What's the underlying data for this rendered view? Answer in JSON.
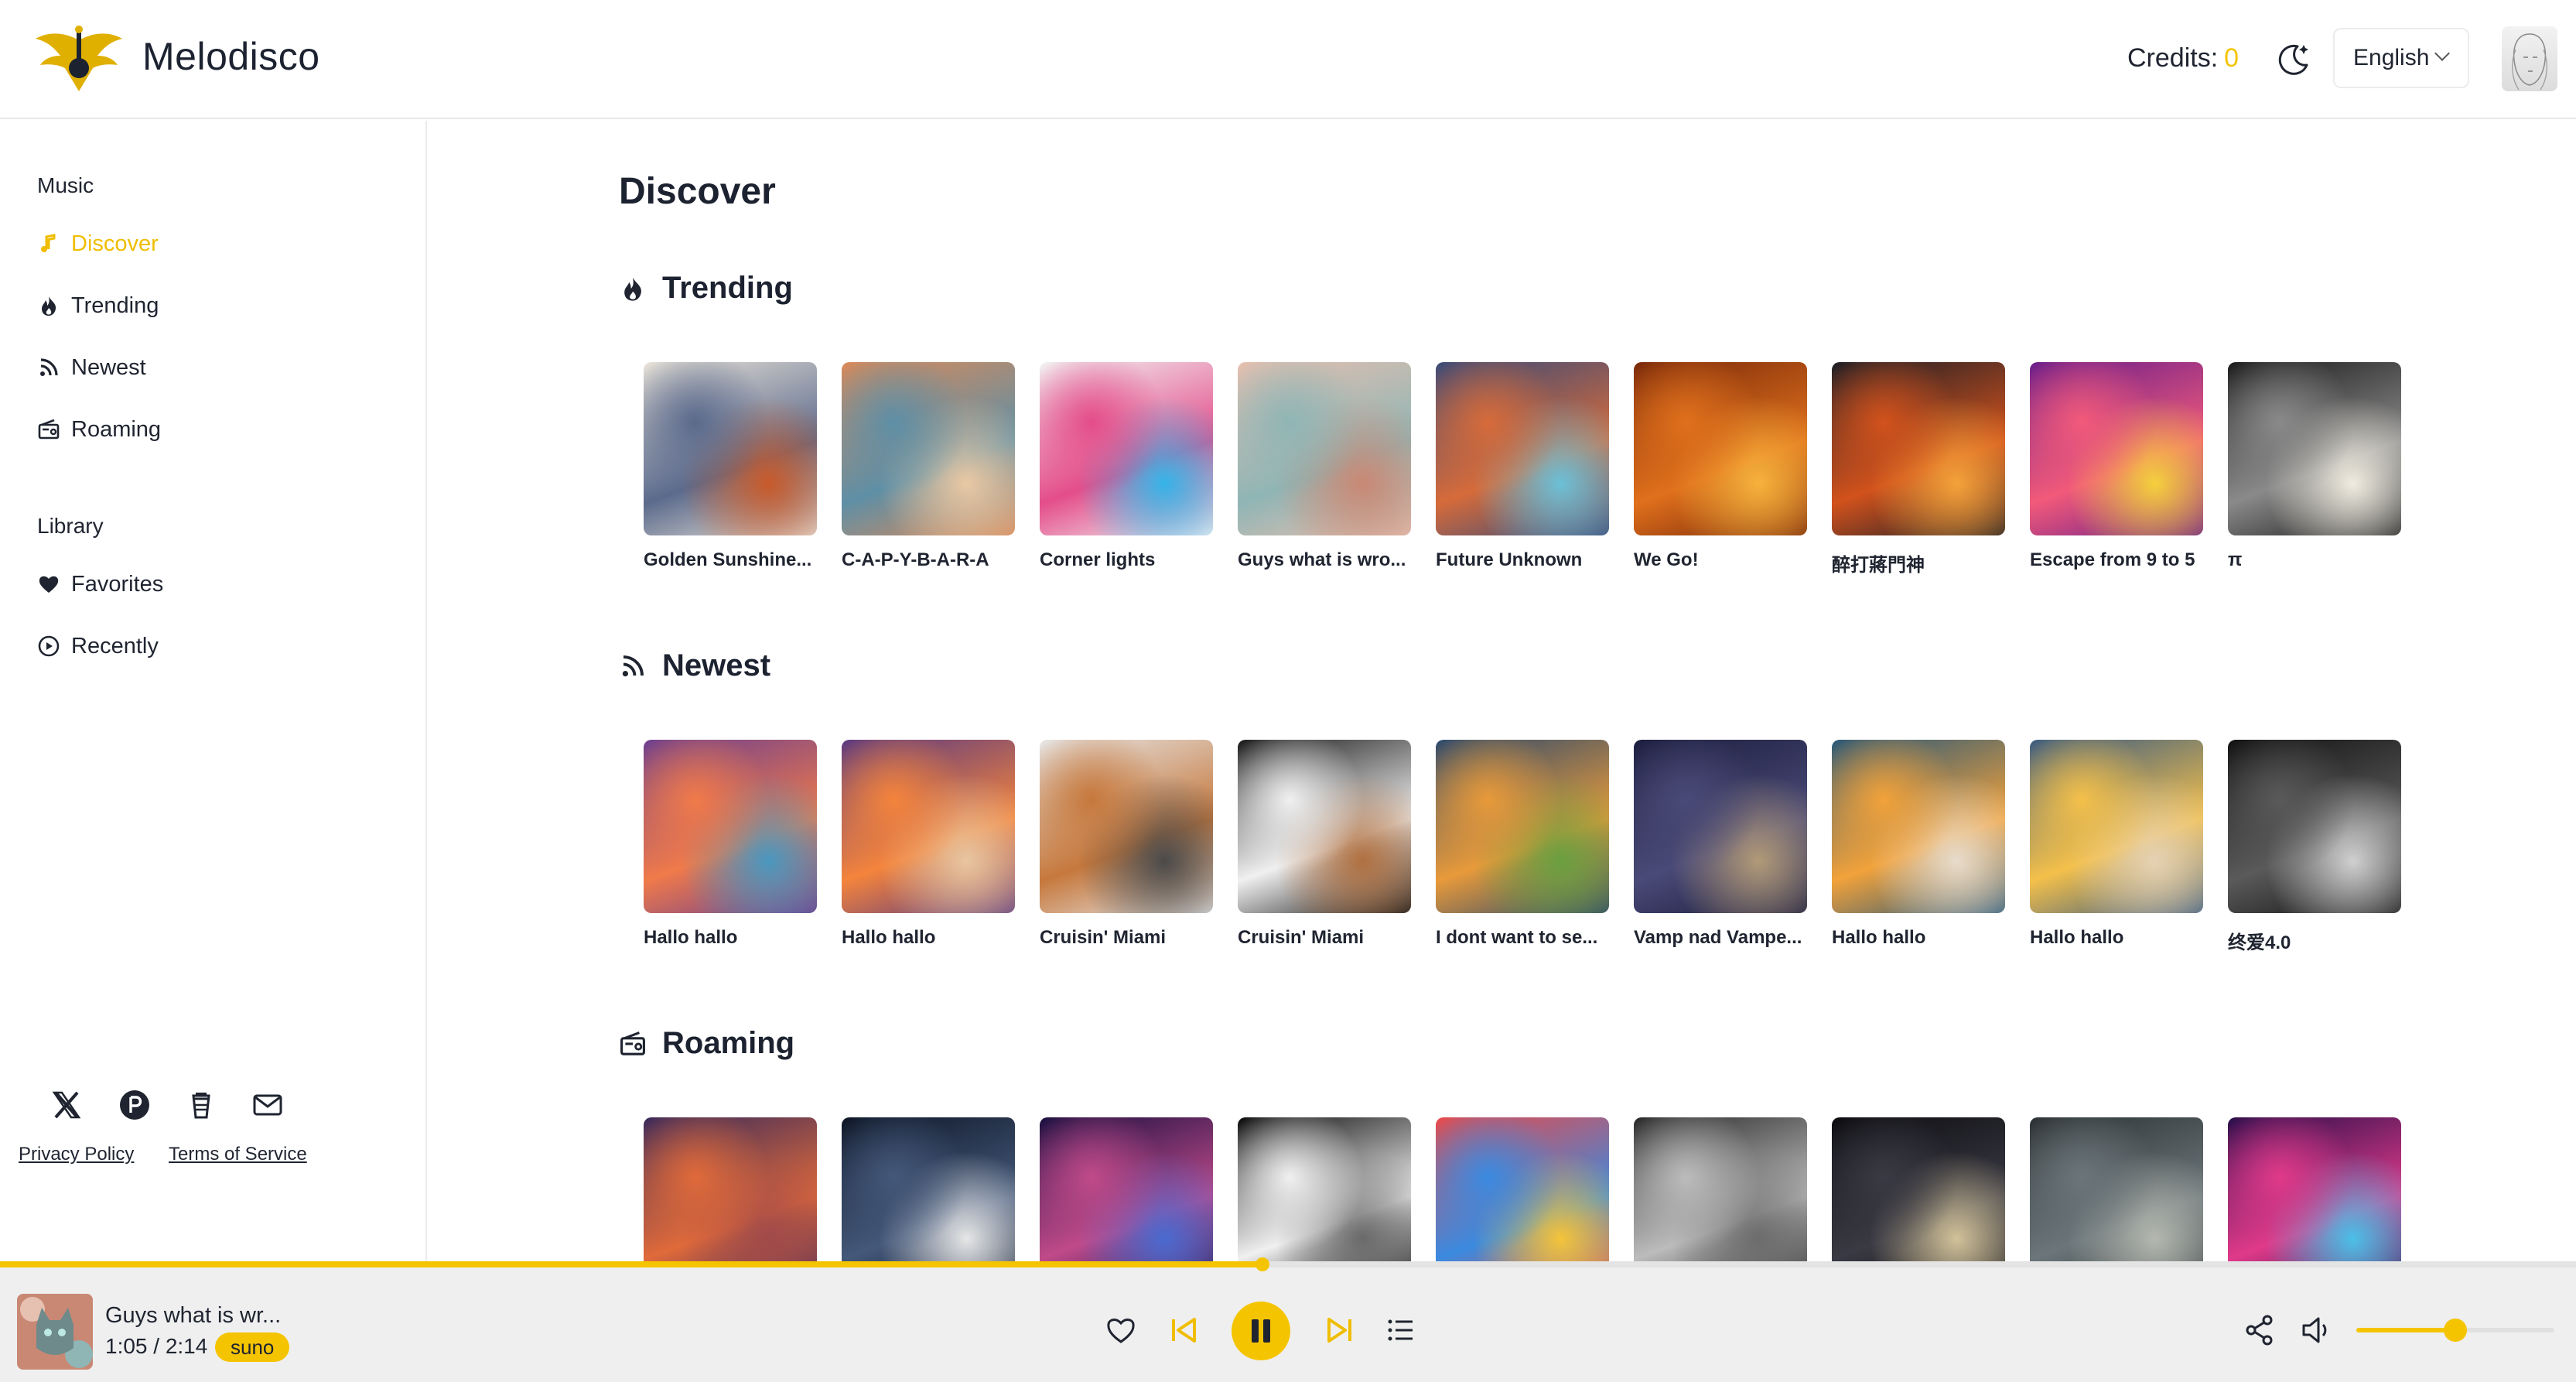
{
  "header": {
    "brand": "Melodisco",
    "credits_label": "Credits:",
    "credits_value": "0",
    "language": "English"
  },
  "sidebar": {
    "music_title": "Music",
    "music_items": [
      {
        "label": "Discover",
        "icon": "music-note-icon",
        "active": true
      },
      {
        "label": "Trending",
        "icon": "flame-icon",
        "active": false
      },
      {
        "label": "Newest",
        "icon": "rss-icon",
        "active": false
      },
      {
        "label": "Roaming",
        "icon": "radio-icon",
        "active": false
      }
    ],
    "library_title": "Library",
    "library_items": [
      {
        "label": "Favorites",
        "icon": "heart-icon"
      },
      {
        "label": "Recently",
        "icon": "play-circle-icon"
      }
    ],
    "social_icons": [
      "x-icon",
      "product-hunt-icon",
      "coffee-cup-icon",
      "mail-icon"
    ],
    "footer_links": [
      "Privacy Policy",
      "Terms of Service"
    ]
  },
  "main": {
    "title": "Discover",
    "sections": [
      {
        "title": "Trending",
        "icon": "flame-icon",
        "cards": [
          {
            "label": "Golden Sunshine...",
            "colors": [
              "#e8e2d8",
              "#5b6a8c",
              "#c85a2a"
            ]
          },
          {
            "label": "C-A-P-Y-B-A-R-A",
            "colors": [
              "#d98a5a",
              "#5e8fa6",
              "#e9c9a4"
            ]
          },
          {
            "label": "Corner lights",
            "colors": [
              "#f2f2f2",
              "#e44d8a",
              "#35b4e8"
            ]
          },
          {
            "label": "Guys what is wro...",
            "colors": [
              "#e6c0b0",
              "#8fb5b5",
              "#c98874"
            ]
          },
          {
            "label": "Future Unknown",
            "colors": [
              "#3b4a78",
              "#d66b3a",
              "#6cc0d8"
            ]
          },
          {
            "label": "We Go!",
            "colors": [
              "#7a2a0a",
              "#e0701c",
              "#f6b23c"
            ]
          },
          {
            "label": "醉打蔣門神",
            "colors": [
              "#1e1e26",
              "#d2521c",
              "#f4a23a"
            ]
          },
          {
            "label": "Escape from 9 to 5",
            "colors": [
              "#6b1e8a",
              "#f25a7a",
              "#f4d03c"
            ]
          },
          {
            "label": "π",
            "colors": [
              "#1c1c1c",
              "#8a8a8a",
              "#f0ece0"
            ]
          }
        ]
      },
      {
        "title": "Newest",
        "icon": "rss-icon",
        "cards": [
          {
            "label": "Hallo hallo",
            "colors": [
              "#6d3f8e",
              "#f07a4a",
              "#4a98c0"
            ]
          },
          {
            "label": "Hallo hallo",
            "colors": [
              "#5c3a80",
              "#f4843c",
              "#e8c6a0"
            ]
          },
          {
            "label": "Cruisin' Miami",
            "colors": [
              "#e6e6e6",
              "#c6783c",
              "#4a4a4a"
            ]
          },
          {
            "label": "Cruisin' Miami",
            "colors": [
              "#1a1a1a",
              "#f0f0f0",
              "#b07040"
            ]
          },
          {
            "label": "I dont want to se...",
            "colors": [
              "#2e4a6c",
              "#e89a3a",
              "#6aa040"
            ]
          },
          {
            "label": "Vamp nad Vampe...",
            "colors": [
              "#1c1e3e",
              "#4a4a78",
              "#b29a78"
            ]
          },
          {
            "label": "Hallo hallo",
            "colors": [
              "#2a5878",
              "#f2a23a",
              "#e8dccc"
            ]
          },
          {
            "label": "Hallo hallo",
            "colors": [
              "#3c5c80",
              "#f4c04a",
              "#e6d2b4"
            ]
          },
          {
            "label": "终爱4.0",
            "colors": [
              "#121212",
              "#5a5a5a",
              "#d0d0d0"
            ]
          }
        ]
      },
      {
        "title": "Roaming",
        "icon": "radio-icon",
        "cards": [
          {
            "label": "",
            "colors": [
              "#3a2a5a",
              "#e06a3a",
              "#a04a4a"
            ]
          },
          {
            "label": "",
            "colors": [
              "#0e1626",
              "#44587a",
              "#e6e6e6"
            ]
          },
          {
            "label": "",
            "colors": [
              "#1a1040",
              "#c04a8a",
              "#4a6ad0"
            ]
          },
          {
            "label": "",
            "colors": [
              "#0c0c0c",
              "#f0f0f0",
              "#6a6a6a"
            ]
          },
          {
            "label": "",
            "colors": [
              "#e84a4a",
              "#3a8ae0",
              "#f4c43a"
            ]
          },
          {
            "label": "",
            "colors": [
              "#2a2a2a",
              "#bcbcbc",
              "#6c6c6c"
            ]
          },
          {
            "label": "",
            "colors": [
              "#0c0c10",
              "#3a3a44",
              "#d2c29a"
            ]
          },
          {
            "label": "",
            "colors": [
              "#2c3234",
              "#6c767a",
              "#b4b8b0"
            ]
          },
          {
            "label": "",
            "colors": [
              "#2a0e4a",
              "#e03a8a",
              "#4ac0e8"
            ]
          }
        ]
      }
    ]
  },
  "player": {
    "title": "Guys what is wr...",
    "time": "1:05 / 2:14",
    "badge": "suno",
    "progress": 0.49,
    "volume": 0.5,
    "controls": [
      "heart-icon",
      "skip-back-icon",
      "pause-icon",
      "skip-forward-icon",
      "playlist-icon"
    ],
    "right_icons": [
      "share-icon",
      "volume-icon"
    ]
  },
  "accent_color": "#f5c400"
}
